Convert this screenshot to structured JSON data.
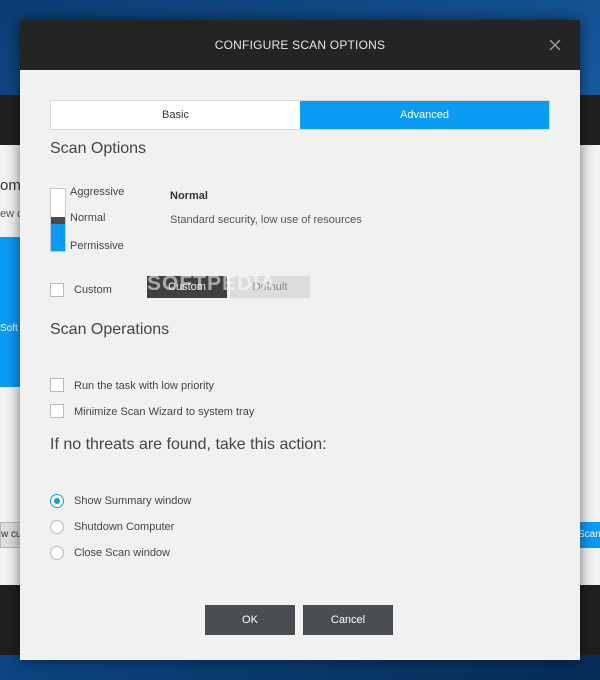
{
  "background": {
    "text_a": "om",
    "text_b": "ew c",
    "blue_panel_text": "Soft",
    "left_button": "w cu",
    "right_button": "Scan"
  },
  "dialog": {
    "title": "CONFIGURE SCAN OPTIONS",
    "tabs": [
      {
        "label": "Basic",
        "active": false
      },
      {
        "label": "Advanced",
        "active": true
      }
    ],
    "scan_options": {
      "heading": "Scan Options",
      "levels": [
        "Aggressive",
        "Normal",
        "Permissive"
      ],
      "selected_level": "Normal",
      "selected_name": "Normal",
      "selected_description": "Standard security, low use of resources",
      "custom_checkbox_label": "Custom",
      "custom_checked": false,
      "custom_button": "Custom",
      "default_button": "Default",
      "watermark": "SOFTPEDIA"
    },
    "scan_operations": {
      "heading": "Scan Operations",
      "options": [
        {
          "label": "Run the task with low priority",
          "checked": false
        },
        {
          "label": "Minimize Scan Wizard to system tray",
          "checked": false
        }
      ]
    },
    "no_threats": {
      "heading": "If no threats are found, take this action:",
      "options": [
        {
          "label": "Show Summary window",
          "selected": true
        },
        {
          "label": "Shutdown Computer",
          "selected": false
        },
        {
          "label": "Close Scan window",
          "selected": false
        }
      ]
    },
    "ok_button": "OK",
    "cancel_button": "Cancel"
  },
  "colors": {
    "accent": "#0a9cf5",
    "titlebar": "#232426",
    "dialog_bg": "#f1f1f1",
    "button_dark": "#4a4d51"
  },
  "icons": {
    "close": "close-icon"
  }
}
